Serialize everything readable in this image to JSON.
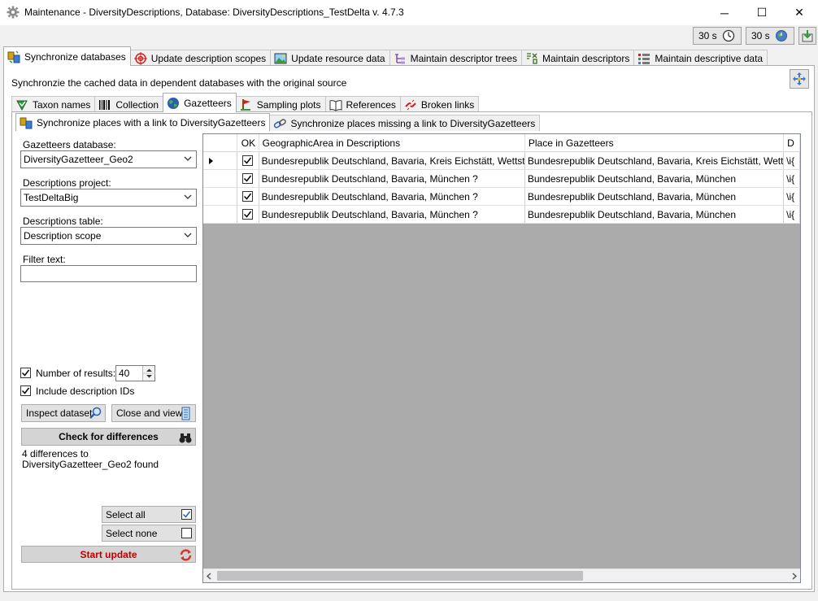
{
  "window": {
    "title": "Maintenance - DiversityDescriptions,  Database: DiversityDescriptions_TestDelta    v. 4.7.3",
    "minimize": "─",
    "maximize": "☐",
    "close": "✕"
  },
  "timers": [
    {
      "label": "30 s",
      "icon": "clock-icon"
    },
    {
      "label": "30 s",
      "icon": "globe-icon"
    }
  ],
  "main_tabs": [
    {
      "label": "Synchronize databases",
      "icon": "sync-db-icon",
      "active": true
    },
    {
      "label": "Update description scopes",
      "icon": "target-icon"
    },
    {
      "label": "Update resource data",
      "icon": "image-icon"
    },
    {
      "label": "Maintain descriptor trees",
      "icon": "tree-icon"
    },
    {
      "label": "Maintain descriptors",
      "icon": "descriptor-icon"
    },
    {
      "label": "Maintain descriptive data",
      "icon": "data-icon"
    }
  ],
  "description": "Synchronzie the cached data in dependent databases with the original source",
  "sub_tabs": [
    {
      "label": "Taxon names",
      "icon": "taxon-icon"
    },
    {
      "label": "Collection",
      "icon": "barcode-icon"
    },
    {
      "label": "Gazetteers",
      "icon": "globe-icon",
      "active": true
    },
    {
      "label": "Sampling plots",
      "icon": "plot-icon"
    },
    {
      "label": "References",
      "icon": "book-icon"
    },
    {
      "label": "Broken links",
      "icon": "broken-link-icon"
    }
  ],
  "sync_tabs": [
    {
      "label": "Synchronize places with a link to DiversityGazetteers",
      "active": true
    },
    {
      "label": "Synchronize places missing a link to DiversityGazetteers"
    }
  ],
  "form": {
    "gazetteers_label": "Gazetteers database:",
    "gazetteers_value": "DiversityGazetteer_Geo2",
    "project_label": "Descriptions project:",
    "project_value": "TestDeltaBig",
    "table_label": "Descriptions table:",
    "table_value": "Description scope",
    "filter_label": "Filter text:",
    "filter_value": "",
    "num_results_label": "Number of results:",
    "num_results_value": "40",
    "include_ids_label": "Include description IDs",
    "inspect_label": "Inspect dataset",
    "close_view_label": "Close and view",
    "check_label": "Check for differences",
    "result_text": "4 differences to DiversityGazetteer_Geo2 found",
    "select_all_label": "Select all",
    "select_none_label": "Select none",
    "start_update_label": "Start update"
  },
  "grid": {
    "headers": [
      "OK",
      "GeographicArea in Descriptions",
      "Place in Gazetteers",
      "D"
    ],
    "rows": [
      {
        "ok": true,
        "area": "Bundesrepublik Deutschland, Bavaria, Kreis Eichstätt, Wettstetten ?",
        "place": "Bundesrepublik Deutschland, Bavaria, Kreis Eichstätt, Wettstetten",
        "d": "\\i{"
      },
      {
        "ok": true,
        "area": "Bundesrepublik Deutschland, Bavaria, München ?",
        "place": "Bundesrepublik Deutschland, Bavaria, München",
        "d": "\\i{"
      },
      {
        "ok": true,
        "area": "Bundesrepublik Deutschland, Bavaria, München ?",
        "place": "Bundesrepublik Deutschland, Bavaria, München",
        "d": "\\i{"
      },
      {
        "ok": true,
        "area": "Bundesrepublik Deutschland, Bavaria, München ?",
        "place": "Bundesrepublik Deutschland, Bavaria, München",
        "d": "\\i{"
      }
    ]
  },
  "colors": {
    "accent": "#0078d7",
    "start_update_text": "#c00000"
  }
}
